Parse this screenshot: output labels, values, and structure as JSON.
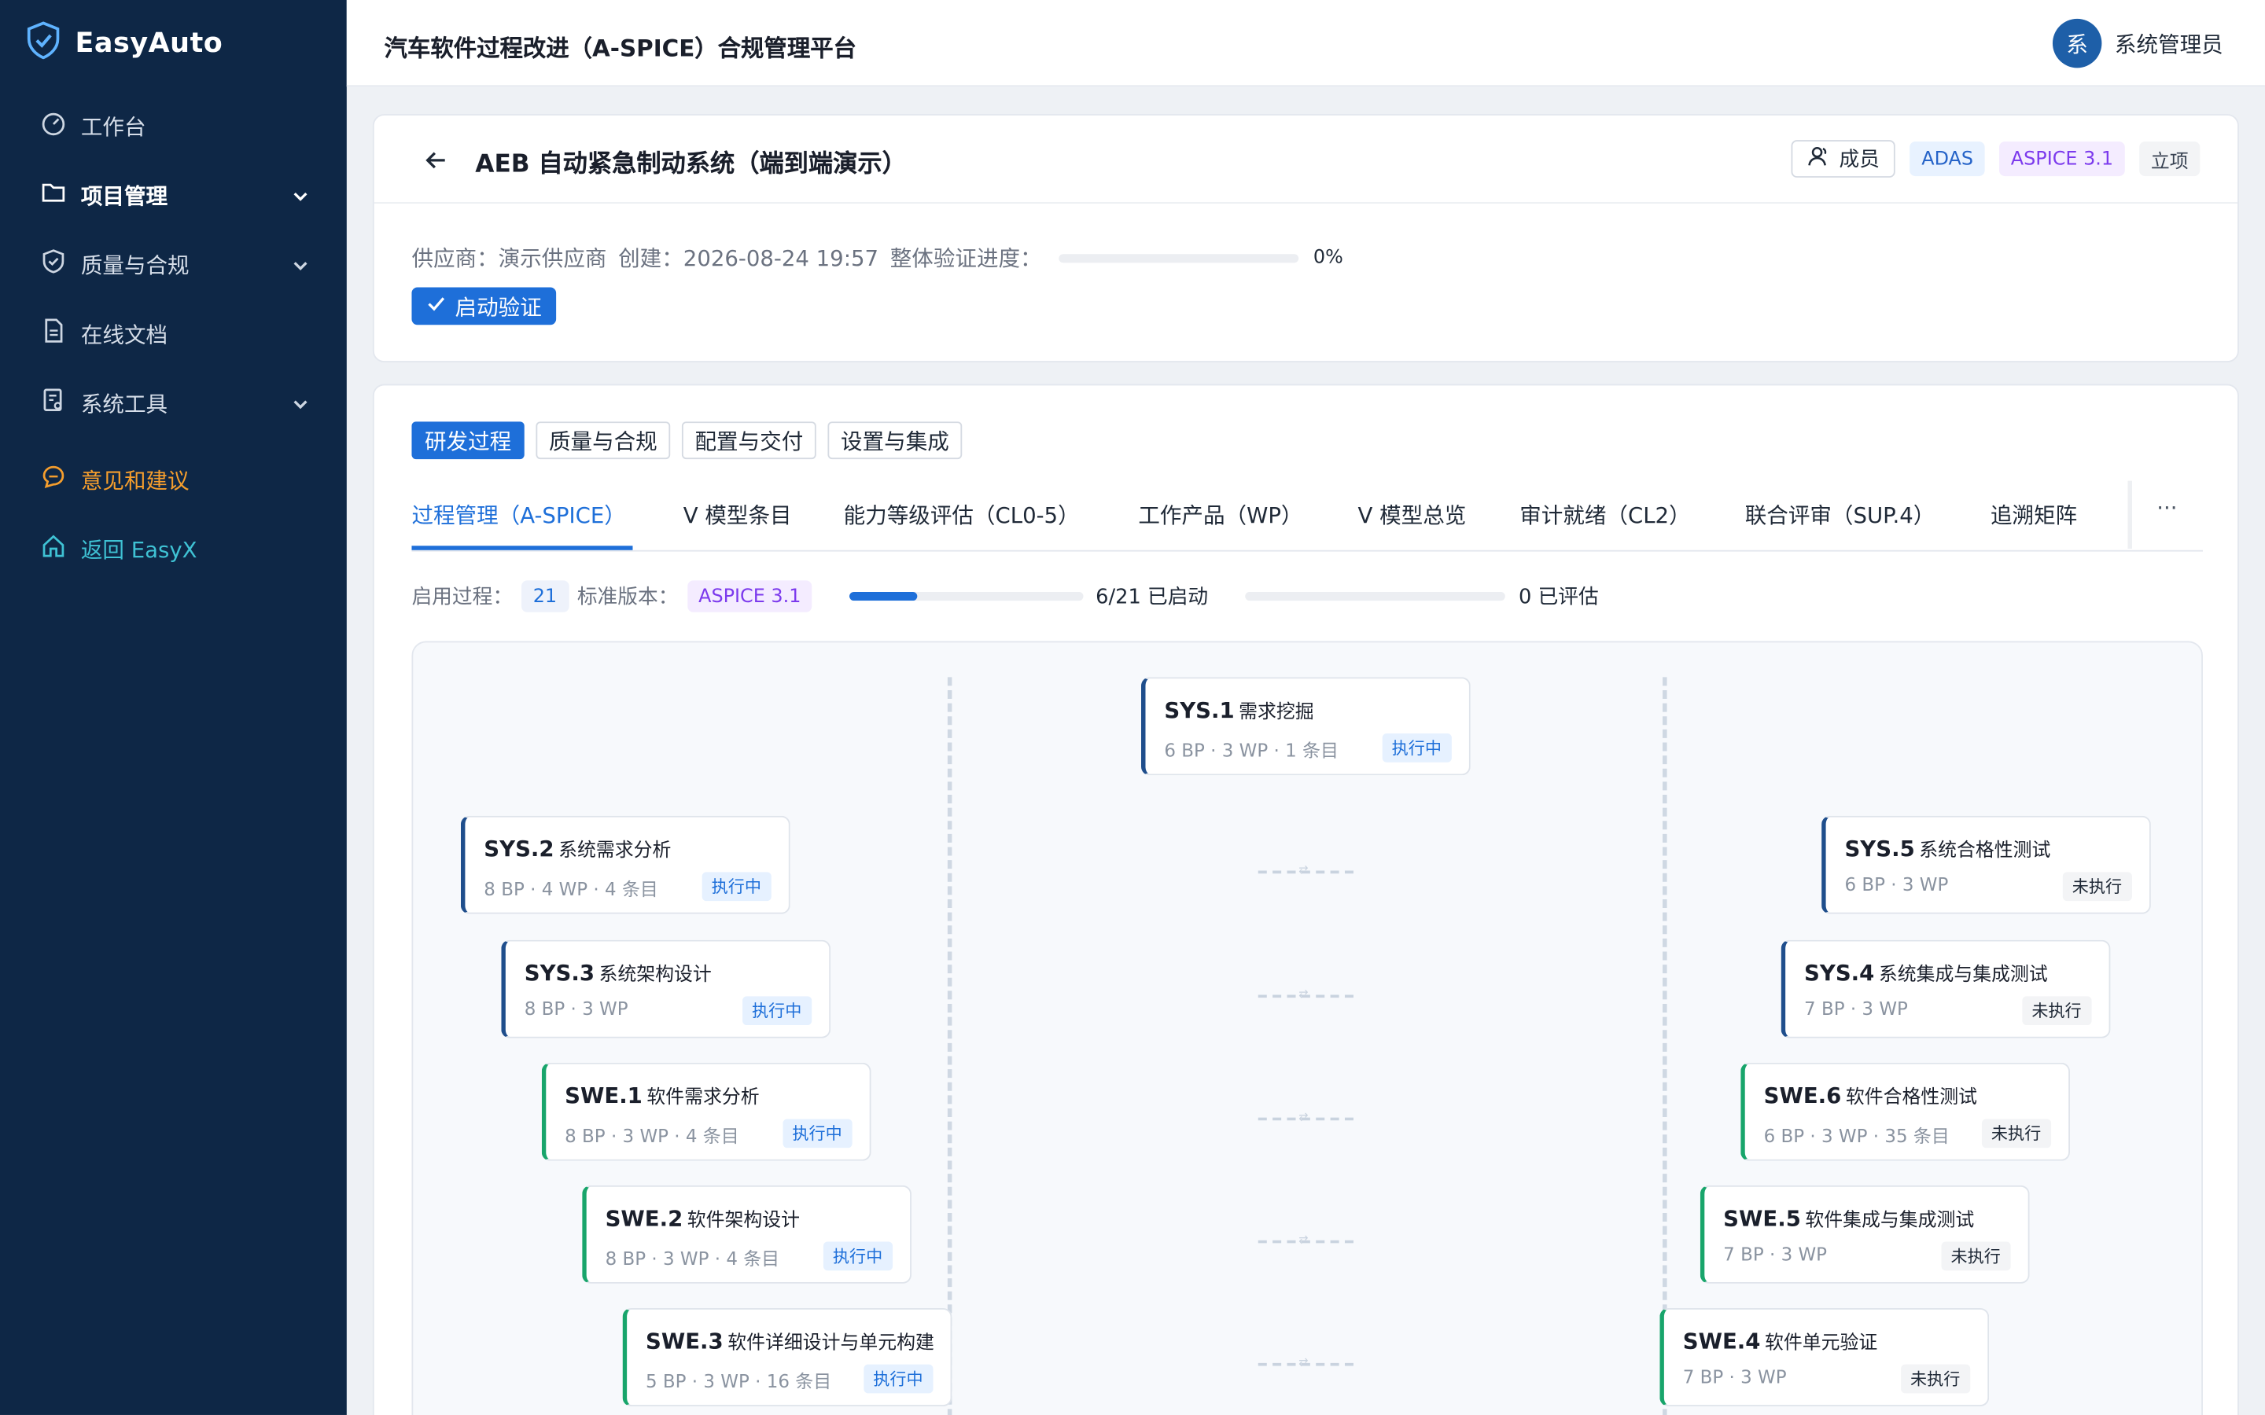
{
  "app": {
    "brand": "EasyAuto",
    "title": "汽车软件过程改进（A-SPICE）合规管理平台"
  },
  "user": {
    "avatar_char": "系",
    "name": "系统管理员"
  },
  "sidebar": {
    "items": [
      {
        "label": "工作台",
        "icon": "dashboard-icon"
      },
      {
        "label": "项目管理",
        "icon": "folder-icon",
        "expandable": true
      },
      {
        "label": "质量与合规",
        "icon": "shield-icon",
        "expandable": true
      },
      {
        "label": "在线文档",
        "icon": "document-icon"
      },
      {
        "label": "系统工具",
        "icon": "tools-icon",
        "expandable": true
      },
      {
        "label": "意见和建议",
        "icon": "feedback-icon"
      },
      {
        "label": "返回 EasyX",
        "icon": "home-icon"
      }
    ]
  },
  "project": {
    "title": "AEB 自动紧急制动系统（端到端演示）",
    "member_label": "成员",
    "tags": [
      "ADAS",
      "ASPICE 3.1",
      "立项"
    ],
    "supplier": "供应商：演示供应商",
    "created": "创建：2026-08-24 19:57",
    "progress_label": "整体验证进度：",
    "progress_value": 0,
    "progress_text": "0%",
    "start_button": "启动验证"
  },
  "segments": [
    "研发过程",
    "质量与合规",
    "配置与交付",
    "设置与集成"
  ],
  "tabs": [
    "过程管理（A-SPICE）",
    "V 模型条目",
    "能力等级评估（CL0-5）",
    "工作产品（WP）",
    "V 模型总览",
    "审计就绪（CL2）",
    "联合评审（SUP.4）",
    "追溯矩阵"
  ],
  "tabs_more": "···",
  "stats": {
    "enabled_label": "启用过程：",
    "enabled_count": "21",
    "version_label": "标准版本：",
    "version_value": "ASPICE 3.1",
    "started_fraction": 0.2857,
    "started_text": "6/21 已启动",
    "evaluated_fraction": 0,
    "evaluated_text": "0 已评估"
  },
  "vmodel": {
    "top": {
      "id": "SYS.1",
      "name": "需求挖掘",
      "meta": "6 BP · 3 WP · 1 条目",
      "status": "执行中"
    },
    "left": [
      {
        "id": "SYS.2",
        "name": "系统需求分析",
        "meta": "8 BP · 4 WP · 4 条目",
        "status": "执行中"
      },
      {
        "id": "SYS.3",
        "name": "系统架构设计",
        "meta": "8 BP · 3 WP",
        "status": "执行中"
      },
      {
        "id": "SWE.1",
        "name": "软件需求分析",
        "meta": "8 BP · 3 WP · 4 条目",
        "status": "执行中"
      },
      {
        "id": "SWE.2",
        "name": "软件架构设计",
        "meta": "8 BP · 3 WP · 4 条目",
        "status": "执行中"
      },
      {
        "id": "SWE.3",
        "name": "软件详细设计与单元构建",
        "meta": "5 BP · 3 WP · 16 条目",
        "status": "执行中"
      }
    ],
    "right": [
      {
        "id": "SYS.5",
        "name": "系统合格性测试",
        "meta": "6 BP · 3 WP",
        "status": "未执行"
      },
      {
        "id": "SYS.4",
        "name": "系统集成与集成测试",
        "meta": "7 BP · 3 WP",
        "status": "未执行"
      },
      {
        "id": "SWE.6",
        "name": "软件合格性测试",
        "meta": "6 BP · 3 WP · 35 条目",
        "status": "未执行"
      },
      {
        "id": "SWE.5",
        "name": "软件集成与集成测试",
        "meta": "7 BP · 3 WP",
        "status": "未执行"
      },
      {
        "id": "SWE.4",
        "name": "软件单元验证",
        "meta": "7 BP · 3 WP",
        "status": "未执行"
      }
    ]
  },
  "colors": {
    "sidebar_bg": "#0e2746",
    "accent": "#1e6fd9",
    "system_stripe": "#1f4e8c",
    "software_stripe": "#18a56b",
    "feedback": "#f59e2d",
    "back_link": "#3fc2d4"
  }
}
